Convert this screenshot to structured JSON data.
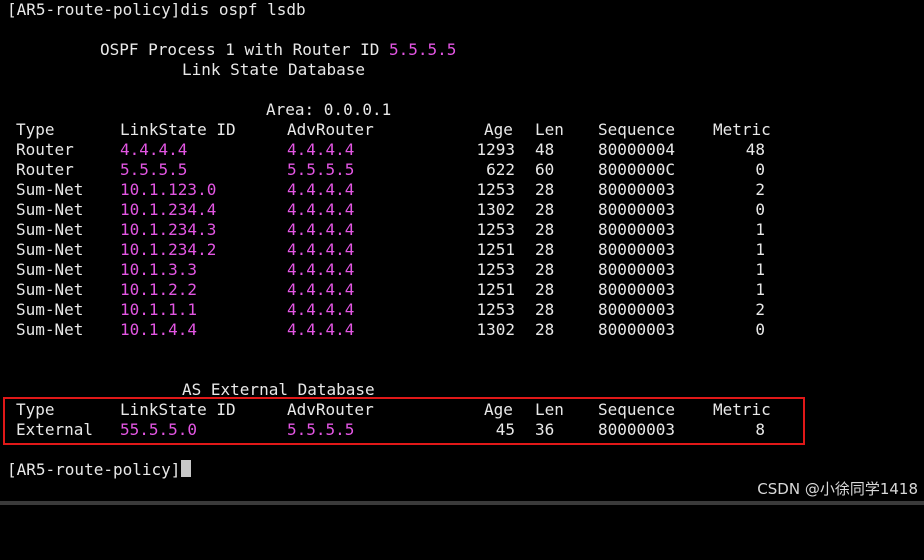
{
  "terminal": {
    "command_prompt": "[AR5-route-policy]",
    "command": "dis ospf lsdb",
    "process_title": "OSPF Process 1 with Router ID",
    "router_id": "5.5.5.5",
    "db_title": "Link State Database",
    "area_label": "Area: 0.0.0.1",
    "columns": {
      "type": "Type",
      "linkstate_id": "LinkState ID",
      "adv_router": "AdvRouter",
      "age": "Age",
      "len": "Len",
      "sequence": "Sequence",
      "metric": "Metric"
    },
    "area_rows": [
      {
        "type": "Router",
        "lsid": "4.4.4.4",
        "adv": "4.4.4.4",
        "age": "1293",
        "len": "48",
        "seq": "80000004",
        "metric": "48"
      },
      {
        "type": "Router",
        "lsid": "5.5.5.5",
        "adv": "5.5.5.5",
        "age": "622",
        "len": "60",
        "seq": "8000000C",
        "metric": "0"
      },
      {
        "type": "Sum-Net",
        "lsid": "10.1.123.0",
        "adv": "4.4.4.4",
        "age": "1253",
        "len": "28",
        "seq": "80000003",
        "metric": "2"
      },
      {
        "type": "Sum-Net",
        "lsid": "10.1.234.4",
        "adv": "4.4.4.4",
        "age": "1302",
        "len": "28",
        "seq": "80000003",
        "metric": "0"
      },
      {
        "type": "Sum-Net",
        "lsid": "10.1.234.3",
        "adv": "4.4.4.4",
        "age": "1253",
        "len": "28",
        "seq": "80000003",
        "metric": "1"
      },
      {
        "type": "Sum-Net",
        "lsid": "10.1.234.2",
        "adv": "4.4.4.4",
        "age": "1251",
        "len": "28",
        "seq": "80000003",
        "metric": "1"
      },
      {
        "type": "Sum-Net",
        "lsid": "10.1.3.3",
        "adv": "4.4.4.4",
        "age": "1253",
        "len": "28",
        "seq": "80000003",
        "metric": "1"
      },
      {
        "type": "Sum-Net",
        "lsid": "10.1.2.2",
        "adv": "4.4.4.4",
        "age": "1251",
        "len": "28",
        "seq": "80000003",
        "metric": "1"
      },
      {
        "type": "Sum-Net",
        "lsid": "10.1.1.1",
        "adv": "4.4.4.4",
        "age": "1253",
        "len": "28",
        "seq": "80000003",
        "metric": "2"
      },
      {
        "type": "Sum-Net",
        "lsid": "10.1.4.4",
        "adv": "4.4.4.4",
        "age": "1302",
        "len": "28",
        "seq": "80000003",
        "metric": "0"
      }
    ],
    "ext_title": "AS External Database",
    "ext_rows": [
      {
        "type": "External",
        "lsid": "55.5.5.0",
        "adv": "5.5.5.5",
        "age": "45",
        "len": "36",
        "seq": "80000003",
        "metric": "8"
      }
    ],
    "final_prompt": "[AR5-route-policy]"
  },
  "watermark": "CSDN @小徐同学1418",
  "colors": {
    "background": "#000000",
    "text": "#e8e8e8",
    "accent_magenta": "#e356e3",
    "highlight_border": "#e01818"
  }
}
